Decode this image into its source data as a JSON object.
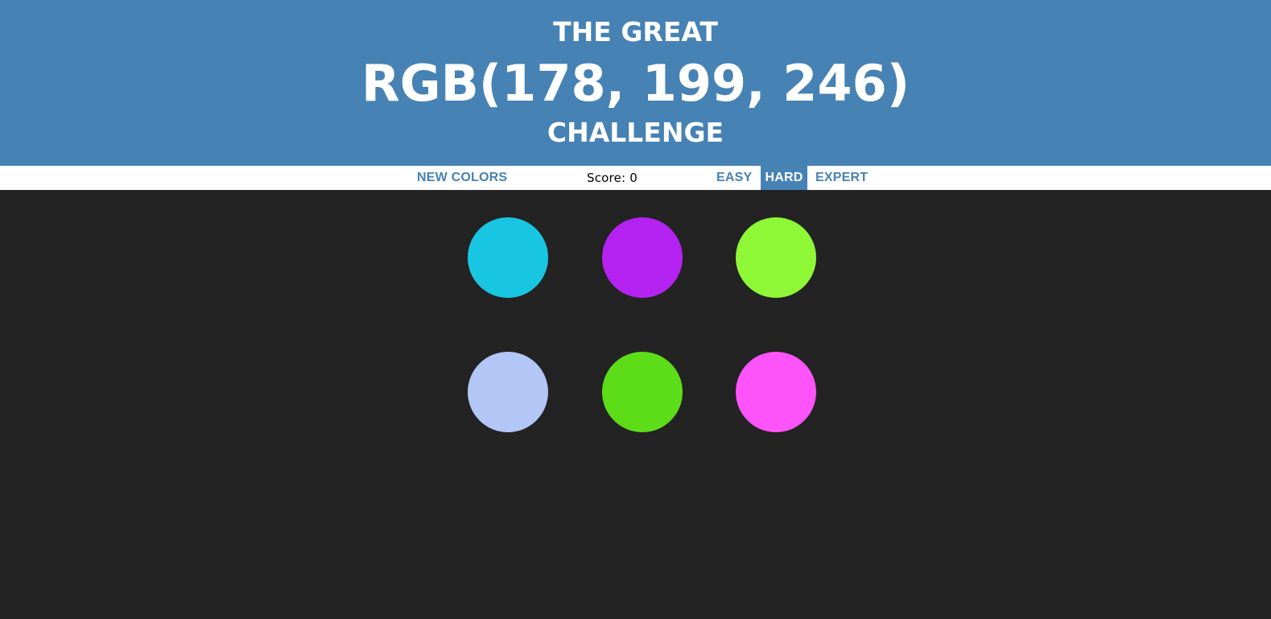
{
  "header": {
    "line1": "THE GREAT",
    "target_color": "RGB(178, 199, 246)",
    "line3": "CHALLENGE",
    "background": "#4682b4"
  },
  "toolbar": {
    "new_colors_label": "NEW COLORS",
    "score_text": "Score: 0",
    "modes": [
      {
        "label": "EASY",
        "selected": false
      },
      {
        "label": "HARD",
        "selected": true
      },
      {
        "label": "EXPERT",
        "selected": false
      }
    ]
  },
  "board": {
    "background": "#232323",
    "circles": [
      "#19c6e2",
      "#b423f2",
      "#8ef736",
      "#b2c7f6",
      "#5ddd18",
      "#fc54f9"
    ]
  }
}
